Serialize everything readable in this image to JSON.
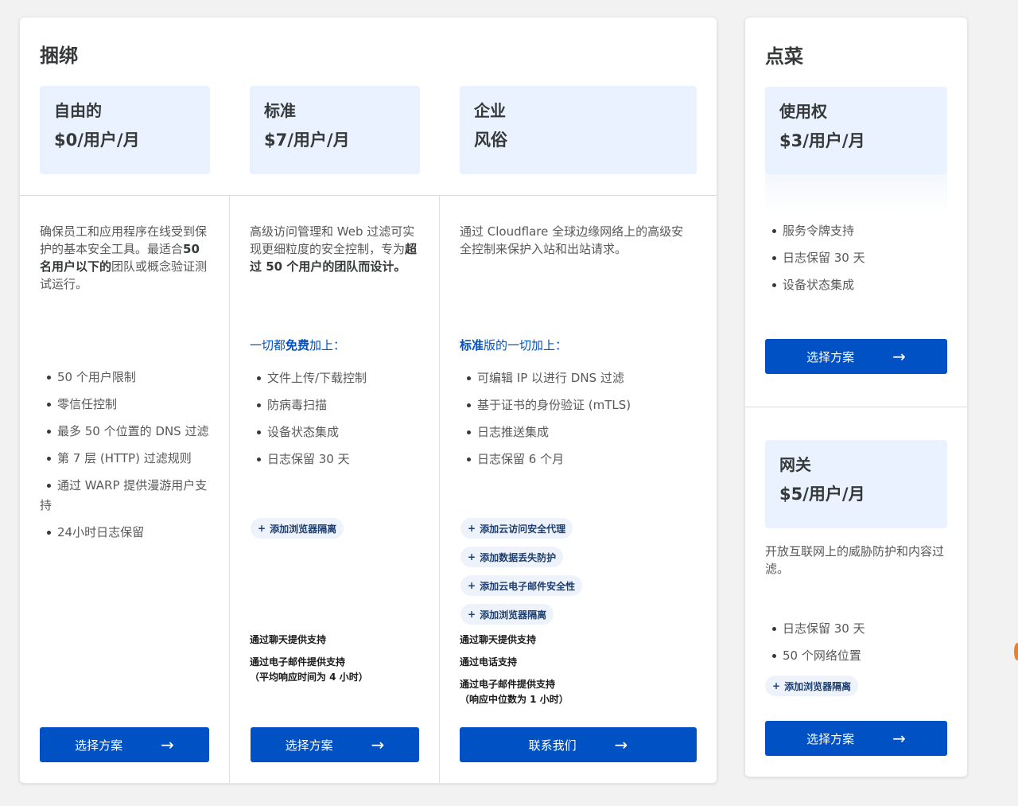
{
  "bundle": {
    "title": "捆绑",
    "plans": [
      {
        "name": "自由的",
        "price": "$0/用户/月",
        "desc_parts": [
          "确保员工和应用程序在线受到保护的基本安全工具。最适合",
          "50名用户以下的",
          "团队或概念验证测试运行。"
        ],
        "features": [
          "50 个用户限制",
          "零信任控制",
          "最多 50 个位置的 DNS 过滤",
          "第 7 层 (HTTP) 过滤规则",
          "通过 WARP 提供漫游用户支持",
          "24小时日志保留"
        ],
        "button": "选择方案"
      },
      {
        "name": "标准",
        "price": "$7/用户/月",
        "desc_parts": [
          "高级访问管理和 Web 过滤可实现更细粒度的安全控制，专为",
          "超过 50 个用户的团队而设计。"
        ],
        "plus_parts": [
          "一切都",
          "免费",
          "加上："
        ],
        "features": [
          "文件上传/下载控制",
          "防病毒扫描",
          "设备状态集成",
          "日志保留 30 天"
        ],
        "addons": [
          "添加浏览器隔离"
        ],
        "support": [
          "通过聊天提供支持",
          "通过电子邮件提供支持",
          "（平均响应时间为 4 小时）"
        ],
        "button": "选择方案"
      },
      {
        "name": "企业",
        "price": "风俗",
        "desc": "通过 Cloudflare 全球边缘网络上的高级安全控制来保护入站和出站请求。",
        "plus_parts": [
          "标准",
          "版的一切加上："
        ],
        "features": [
          "可编辑 IP 以进行 DNS 过滤",
          "基于证书的身份验证 (mTLS)",
          "日志推送集成",
          "日志保留 6 个月"
        ],
        "addons": [
          "添加云访问安全代理",
          "添加数据丢失防护",
          "添加云电子邮件安全性",
          "添加浏览器隔离"
        ],
        "support": [
          "通过聊天提供支持",
          "通过电话支持",
          "通过电子邮件提供支持",
          "（响应中位数为 1 小时）"
        ],
        "button": "联系我们"
      }
    ]
  },
  "alacarte": {
    "title": "点菜",
    "plans": [
      {
        "name": "使用权",
        "price": "$3/用户/月",
        "features": [
          "服务令牌支持",
          "日志保留 30 天",
          "设备状态集成"
        ],
        "button": "选择方案"
      },
      {
        "name": "网关",
        "price": "$5/用户/月",
        "desc": "开放互联网上的威胁防护和内容过滤。",
        "features": [
          "日志保留 30 天",
          "50 个网络位置"
        ],
        "addons": [
          "添加浏览器隔离"
        ],
        "button": "选择方案"
      }
    ]
  },
  "icons": {
    "arrow": "→",
    "plus": "+"
  },
  "colors": {
    "accent": "#0051c3",
    "price_box_bg": "#eaf2ff",
    "addon_bg": "#eef3fb",
    "page_bg": "#f2f2f2"
  }
}
